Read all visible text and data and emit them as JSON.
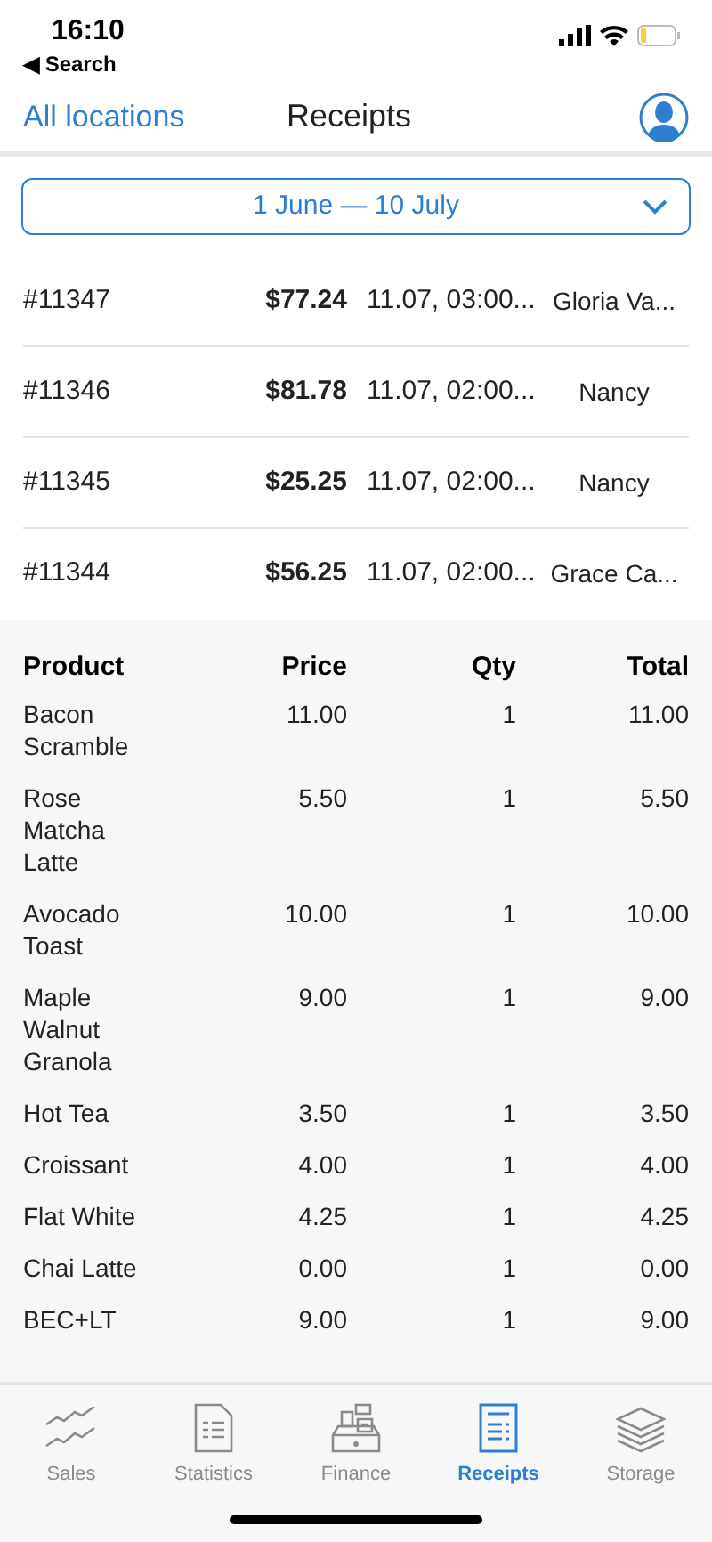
{
  "status_bar": {
    "time": "16:10",
    "back_label": "◀ Search"
  },
  "nav": {
    "left_link": "All locations",
    "title": "Receipts"
  },
  "date_range": {
    "label": "1 June — 10 July"
  },
  "receipts": [
    {
      "number": "#11347",
      "amount": "$77.24",
      "date": "11.07, 03:00...",
      "cashier": "Gloria Va..."
    },
    {
      "number": "#11346",
      "amount": "$81.78",
      "date": "11.07, 02:00...",
      "cashier": "Nancy"
    },
    {
      "number": "#11345",
      "amount": "$25.25",
      "date": "11.07, 02:00...",
      "cashier": "Nancy"
    },
    {
      "number": "#11344",
      "amount": "$56.25",
      "date": "11.07, 02:00...",
      "cashier": "Grace Ca..."
    }
  ],
  "details": {
    "columns": [
      "Product",
      "Price",
      "Qty",
      "Total"
    ],
    "rows": [
      {
        "product": "Bacon Scramble",
        "price": "11.00",
        "qty": "1",
        "total": "11.00"
      },
      {
        "product": "Rose Matcha Latte",
        "price": "5.50",
        "qty": "1",
        "total": "5.50"
      },
      {
        "product": "Avocado Toast",
        "price": "10.00",
        "qty": "1",
        "total": "10.00"
      },
      {
        "product": "Maple Walnut Granola",
        "price": "9.00",
        "qty": "1",
        "total": "9.00"
      },
      {
        "product": "Hot Tea",
        "price": "3.50",
        "qty": "1",
        "total": "3.50"
      },
      {
        "product": "Croissant",
        "price": "4.00",
        "qty": "1",
        "total": "4.00"
      },
      {
        "product": "Flat White",
        "price": "4.25",
        "qty": "1",
        "total": "4.25"
      },
      {
        "product": "Chai Latte",
        "price": "0.00",
        "qty": "1",
        "total": "0.00"
      },
      {
        "product": "BEC+LT",
        "price": "9.00",
        "qty": "1",
        "total": "9.00"
      }
    ]
  },
  "tab_bar": [
    {
      "kind": "sales",
      "label": "Sales",
      "selected": false
    },
    {
      "kind": "statistics",
      "label": "Statistics",
      "selected": false
    },
    {
      "kind": "finance",
      "label": "Finance",
      "selected": false
    },
    {
      "kind": "receipts",
      "label": "Receipts",
      "selected": true
    },
    {
      "kind": "storage",
      "label": "Storage",
      "selected": false
    }
  ]
}
